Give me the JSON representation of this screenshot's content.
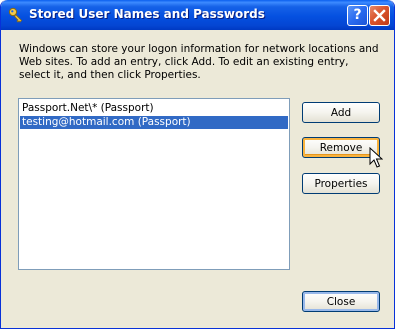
{
  "window": {
    "title": "Stored User Names and Passwords"
  },
  "titlebar_buttons": {
    "help": "?"
  },
  "description": "Windows can store your logon information for network locations and Web sites. To add an entry, click Add. To edit an existing entry, select it, and then click Properties.",
  "entries": [
    {
      "label": "Passport.Net\\* (Passport)",
      "selected": false
    },
    {
      "label": "testing@hotmail.com (Passport)",
      "selected": true
    }
  ],
  "buttons": {
    "add": "Add",
    "remove": "Remove",
    "properties": "Properties",
    "close": "Close"
  },
  "colors": {
    "selection": "#316AC5",
    "titlebar": "#0550E0",
    "dialog_bg": "#ECE9D8"
  }
}
